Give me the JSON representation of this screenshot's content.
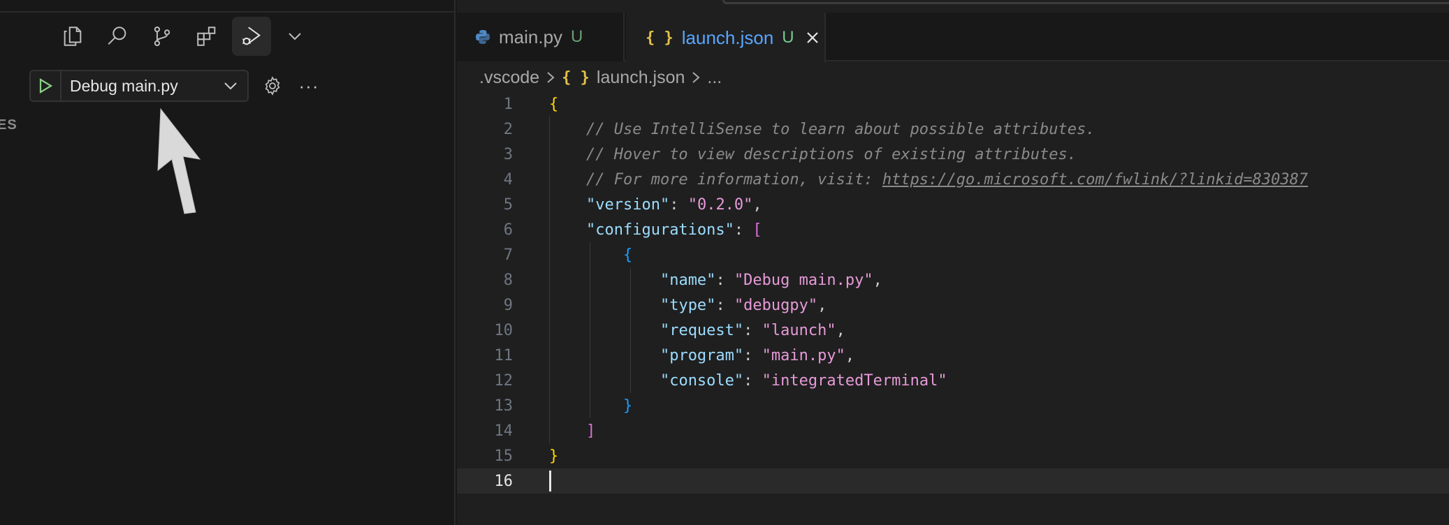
{
  "sidebar": {
    "activity_icons": [
      "files-icon",
      "search-icon",
      "source-control-icon",
      "extensions-icon",
      "run-debug-icon"
    ],
    "run_config": "Debug main.py",
    "more_label": "···",
    "section_stub": "ES"
  },
  "tabs": [
    {
      "name": "main.py",
      "status": "U",
      "icon": "python-icon"
    },
    {
      "name": "launch.json",
      "status": "U",
      "icon": "json-icon",
      "icon_glyph": "{ }"
    }
  ],
  "breadcrumb": {
    "folder": ".vscode",
    "file": "launch.json",
    "tail": "..."
  },
  "code": {
    "line_numbers": [
      "1",
      "2",
      "3",
      "4",
      "5",
      "6",
      "7",
      "8",
      "9",
      "10",
      "11",
      "12",
      "13",
      "14",
      "15",
      "16"
    ],
    "l1": "{",
    "l2": "// Use IntelliSense to learn about possible attributes.",
    "l3": "// Hover to view descriptions of existing attributes.",
    "l4_prefix": "// For more information, visit: ",
    "l4_link": "https://go.microsoft.com/fwlink/?linkid=830387",
    "l5_key": "\"version\"",
    "l5_val": "\"0.2.0\"",
    "l6_key": "\"configurations\"",
    "l6_bracket": "[",
    "l7": "{",
    "l8_key": "\"name\"",
    "l8_val": "\"Debug main.py\"",
    "l9_key": "\"type\"",
    "l9_val": "\"debugpy\"",
    "l10_key": "\"request\"",
    "l10_val": "\"launch\"",
    "l11_key": "\"program\"",
    "l11_val": "\"main.py\"",
    "l12_key": "\"console\"",
    "l12_val": "\"integratedTerminal\"",
    "l13": "}",
    "l14": "]",
    "l15": "}"
  },
  "colors": {
    "accent": "#58a6ff",
    "untracked": "#73c991",
    "background": "#1f1f1f"
  }
}
